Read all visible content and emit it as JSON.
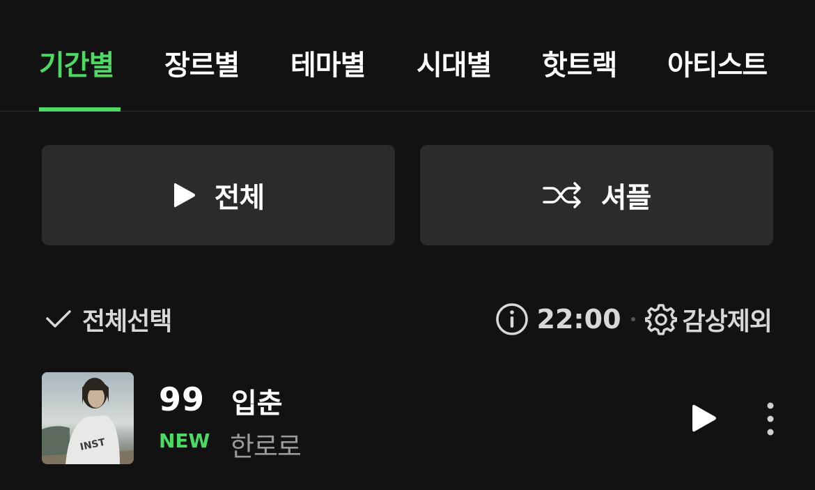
{
  "tabs": [
    {
      "label": "기간별",
      "active": true
    },
    {
      "label": "장르별",
      "active": false
    },
    {
      "label": "테마별",
      "active": false
    },
    {
      "label": "시대별",
      "active": false
    },
    {
      "label": "핫트랙",
      "active": false
    },
    {
      "label": "아티스트",
      "active": false
    }
  ],
  "actions": {
    "play_all_label": "전체",
    "shuffle_label": "셔플"
  },
  "selection": {
    "select_all_label": "전체선택",
    "time": "22:00",
    "exclude_label": "감상제외"
  },
  "track": {
    "rank": "99",
    "badge": "NEW",
    "title": "입춘",
    "artist": "한로로"
  },
  "colors": {
    "accent": "#4cd964",
    "background": "#121212",
    "button_bg": "#2b2b2b"
  }
}
